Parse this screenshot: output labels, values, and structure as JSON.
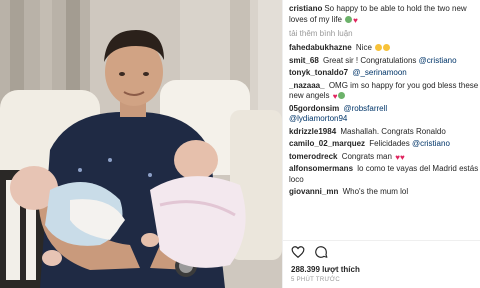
{
  "caption": {
    "user": "cristiano",
    "text": "So happy to be able to hold the two new loves of my life"
  },
  "load_more": "tải thêm bình luận",
  "comments": [
    {
      "user": "fahedabukhazne",
      "text": "Nice",
      "mention": ""
    },
    {
      "user": "smit_68",
      "text": "Great sir ! Congratulations",
      "mention": "@cristiano"
    },
    {
      "user": "tonyk_tonaldo7",
      "text": "",
      "mention": "@_serinamoon"
    },
    {
      "user": "_nazaaa_",
      "text": "OMG im so happy for you god bless these new angels",
      "mention": ""
    },
    {
      "user": "05gordonsim",
      "text": "",
      "mention": "@robsfarrell"
    },
    {
      "user": "",
      "text": "",
      "mention": "@lydiamorton94"
    },
    {
      "user": "kdrizzle1984",
      "text": "Mashallah. Congrats Ronaldo",
      "mention": ""
    },
    {
      "user": "camilo_02_marquez",
      "text": "Felicidades",
      "mention": "@cristiano"
    },
    {
      "user": "tomerodreck",
      "text": "Congrats man",
      "mention": ""
    },
    {
      "user": "alfonsomermans",
      "text": "lo como te vayas del Madrid estás loco",
      "mention": ""
    },
    {
      "user": "giovanni_mn",
      "text": "Who's the mum lol",
      "mention": ""
    }
  ],
  "actions": {
    "like_icon": "heart-icon",
    "comment_icon": "comment-icon",
    "likes": "288.399 lượt thích",
    "time": "5 phút trước"
  },
  "colors": {
    "link": "#003569",
    "muted": "#999999",
    "text": "#262626"
  }
}
